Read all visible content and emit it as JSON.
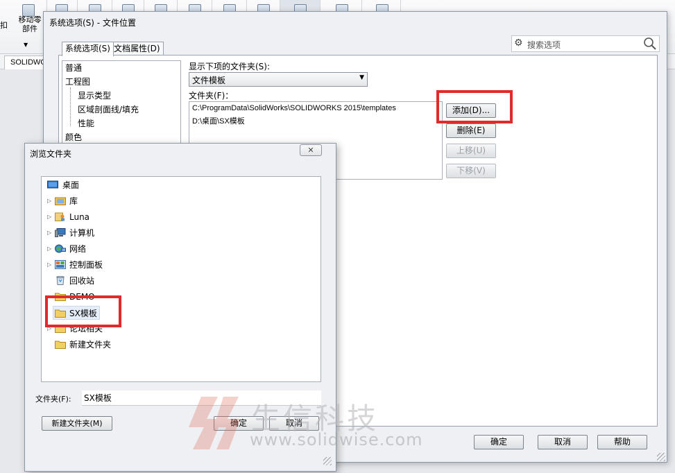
{
  "app": {
    "toolbar_button_label": "移动零\n部件",
    "left_cut_label": "扣",
    "doc_tab": "SOLIDWO"
  },
  "sys_dialog": {
    "title": "系统选项(S) - 文件位置",
    "tabs": [
      "系统选项(S)",
      "文档属性(D)"
    ],
    "search_placeholder": "搜索选项",
    "tree": [
      "普通",
      "工程图",
      "显示类型",
      "区域剖面线/填充",
      "性能",
      "颜色"
    ],
    "show_folders_label": "显示下项的文件夹(S):",
    "combo_value": "文件模板",
    "folders_label": "文件夹(F)：",
    "folders": [
      "C:\\ProgramData\\SolidWorks\\SOLIDWORKS 2015\\templates",
      "D:\\桌面\\SX模板"
    ],
    "buttons": {
      "add": "添加(D)...",
      "delete": "删除(E)",
      "move_up": "上移(U)",
      "move_down": "下移(V)",
      "ok": "确定",
      "cancel": "取消",
      "help": "帮助"
    }
  },
  "browse_dialog": {
    "title": "浏览文件夹",
    "close_glyph": "✕",
    "items": [
      "桌面",
      "库",
      "Luna",
      "计算机",
      "网络",
      "控制面板",
      "回收站",
      "DEMO",
      "SX模板",
      "论坛相关",
      "新建文件夹"
    ],
    "folder_label": "文件夹(F):",
    "folder_value": "SX模板",
    "new_folder": "新建文件夹(M)",
    "ok": "确定",
    "cancel": "取消"
  },
  "watermark": {
    "company": "生信科技",
    "url": "www.solidwise.com"
  },
  "colors": {
    "highlight_red": "#e02b2b",
    "selection": "#e5eef9"
  }
}
